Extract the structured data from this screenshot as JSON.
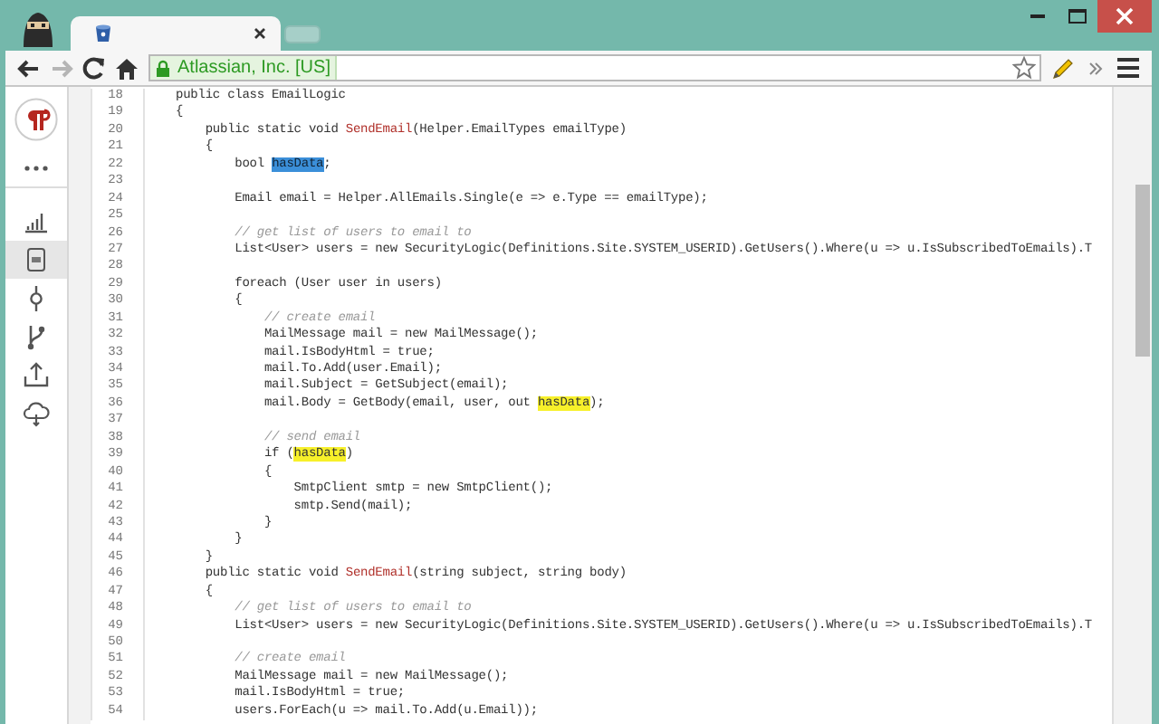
{
  "browser": {
    "tab": {
      "selected": true
    },
    "nav_buttons": [
      {
        "kind": "back",
        "disabled": false
      },
      {
        "kind": "forward",
        "disabled": true
      },
      {
        "kind": "reload",
        "disabled": false
      },
      {
        "kind": "home",
        "disabled": false
      }
    ],
    "address_bar": {
      "identity": "Atlassian, Inc. [US]",
      "secure": true
    }
  },
  "sidebar": {
    "items": [
      {
        "kind": "chart",
        "selected": false
      },
      {
        "kind": "file",
        "selected": true
      },
      {
        "kind": "commit",
        "selected": false
      },
      {
        "kind": "branch",
        "selected": false
      },
      {
        "kind": "upload",
        "selected": false
      },
      {
        "kind": "cloud",
        "selected": false
      }
    ]
  },
  "code": {
    "lines": [
      {
        "number": "18",
        "text": "public class EmailLogic"
      },
      {
        "number": "19",
        "text": "{"
      },
      {
        "number": "20",
        "parts": [
          {
            "kind": "plain",
            "text": "    public static void "
          },
          {
            "kind": "method",
            "text": "SendEmail"
          },
          {
            "kind": "plain",
            "text": "(Helper.EmailTypes emailType)"
          }
        ]
      },
      {
        "number": "21",
        "text": "    {"
      },
      {
        "number": "22",
        "parts": [
          {
            "kind": "plain",
            "text": "        bool "
          },
          {
            "kind": "selection",
            "text": "hasData"
          },
          {
            "kind": "plain",
            "text": ";"
          }
        ]
      },
      {
        "number": "23"
      },
      {
        "number": "24",
        "text": "        Email email = Helper.AllEmails.Single(e => e.Type == emailType);"
      },
      {
        "number": "25"
      },
      {
        "number": "26",
        "kind": "comment",
        "text": "        // get list of users to email to"
      },
      {
        "number": "27",
        "text": "        List<User> users = new SecurityLogic(Definitions.Site.SYSTEM_USERID).GetUsers().Where(u => u.IsSubscribedToEmails).T"
      },
      {
        "number": "28"
      },
      {
        "number": "29",
        "text": "        foreach (User user in users)"
      },
      {
        "number": "30",
        "text": "        {"
      },
      {
        "number": "31",
        "kind": "comment",
        "text": "            // create email"
      },
      {
        "number": "32",
        "text": "            MailMessage mail = new MailMessage();"
      },
      {
        "number": "33",
        "text": "            mail.IsBodyHtml = true;"
      },
      {
        "number": "34",
        "text": "            mail.To.Add(user.Email);"
      },
      {
        "number": "35",
        "text": "            mail.Subject = GetSubject(email);"
      },
      {
        "number": "36",
        "parts": [
          {
            "kind": "plain",
            "text": "            mail.Body = GetBody(email, user, out "
          },
          {
            "kind": "match",
            "text": "hasData"
          },
          {
            "kind": "plain",
            "text": ");"
          }
        ]
      },
      {
        "number": "37"
      },
      {
        "number": "38",
        "kind": "comment",
        "text": "            // send email"
      },
      {
        "number": "39",
        "parts": [
          {
            "kind": "plain",
            "text": "            if ("
          },
          {
            "kind": "match",
            "text": "hasData"
          },
          {
            "kind": "plain",
            "text": ")"
          }
        ]
      },
      {
        "number": "40",
        "text": "            {"
      },
      {
        "number": "41",
        "text": "                SmtpClient smtp = new SmtpClient();"
      },
      {
        "number": "42",
        "text": "                smtp.Send(mail);"
      },
      {
        "number": "43",
        "text": "            }"
      },
      {
        "number": "44",
        "text": "        }"
      },
      {
        "number": "45",
        "text": "    }"
      },
      {
        "number": "46",
        "parts": [
          {
            "kind": "plain",
            "text": "    public static void "
          },
          {
            "kind": "method",
            "text": "SendEmail"
          },
          {
            "kind": "plain",
            "text": "(string subject, string body)"
          }
        ]
      },
      {
        "number": "47",
        "text": "    {"
      },
      {
        "number": "48",
        "kind": "comment",
        "text": "        // get list of users to email to"
      },
      {
        "number": "49",
        "text": "        List<User> users = new SecurityLogic(Definitions.Site.SYSTEM_USERID).GetUsers().Where(u => u.IsSubscribedToEmails).T"
      },
      {
        "number": "50"
      },
      {
        "number": "51",
        "kind": "comment",
        "text": "        // create email"
      },
      {
        "number": "52",
        "text": "        MailMessage mail = new MailMessage();"
      },
      {
        "number": "53",
        "text": "        mail.IsBodyHtml = true;"
      },
      {
        "number": "54",
        "text": "        users.ForEach(u => mail.To.Add(u.Email));"
      }
    ]
  }
}
